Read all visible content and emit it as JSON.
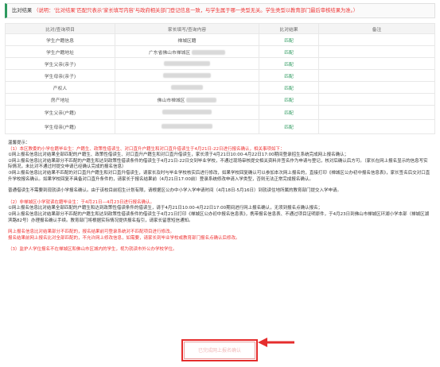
{
  "notice": {
    "label": "比对结果",
    "text": "（说明：‘比对结果’匹配只表示‘家长填写内容’与政府相关部门登记信息一致，与学生属于哪一类型无关。学生类型以教育部门最后审核结果为准。）"
  },
  "table": {
    "headers": [
      "比对/查询项目",
      "家长填写/查询内容",
      "比对结果",
      "备注"
    ],
    "rows": [
      {
        "item": "学生户籍信息",
        "content": "禅城区籍",
        "result": "匹配",
        "note": ""
      },
      {
        "item": "学生户籍地址",
        "content": "广东省佛山市禅城区",
        "result": "匹配",
        "note": ""
      },
      {
        "item": "学生父亲(亲子)",
        "content": "",
        "result": "匹配",
        "note": ""
      },
      {
        "item": "学生母亲(亲子)",
        "content": "",
        "result": "匹配",
        "note": ""
      },
      {
        "item": "产权人",
        "content": "",
        "result": "匹配",
        "note": ""
      },
      {
        "item": "房产地址",
        "content": "佛山市禅城区",
        "result": "匹配",
        "note": ""
      },
      {
        "item": "学生父亲(户籍)",
        "content": "",
        "result": "匹配",
        "note": ""
      },
      {
        "item": "学生母亲(户籍)",
        "content": "",
        "result": "匹配",
        "note": ""
      }
    ]
  },
  "tips": {
    "title": "温馨提示：",
    "s1_heading": "（1）本区教委的小学在籍毕业生：户籍生、政策性借读生、对口直升户籍生和对口直升借读生于4月21日-22日进行报名确认，相关事项如下：",
    "s1_lines": [
      "①网上报名信息比对结果全部匹配的户籍生、政策性借读生、对口直升户籍生和对口直升借读生，家长须于4月21日10:00-4月22日17:00期间登录招生系统完成网上报名确认；",
      "②网上报名信息比对结果部分不匹配的户籍生和达到政策性借读条件的借读生于4月21日-22日交到毕业学校，不通过现场审核提交相关资料并签名作为申请与登记，核对后确认后方可。（家长在网上报名显示的信息写实际情况，未比对不通过时提交申请已经确认完成的报名信息）",
      "③网上报名信息比对结果不匹配的对口直升户籍生和对口直升借读生，请家长及时与毕业学校核实后进行修改，如果学校回复确认可以参加本次网上报名的，直接打印《禅城区公办初中报名信息表》，家长签名后交对口直升学校报名确认。如果学校回复不具备对口直升条件的，请家长于报名结果前（4月21日17:00前）登录系统修改申请入学类型，否则无法正常完成报名确认。",
      "普通借读生不需要到现就读小学报名确认。由于该校目前招生计划有限，请根据区公办中小学入学申请时间（4月18日-5月16日）到就读住地所属的教育部门提交入学申请。"
    ],
    "s2_heading": "（2）非禅城区小学就读在籍毕业生：于4月21日—4月23日进行报名确认。",
    "s2_lines": [
      "①网上报名信息比对结果全部匹配的户籍生和达到政策性借读条件的借读生，请于4月21日10:00-4月22日17:00期间进行网上报名确认，无须到报名点确认报名；",
      "②网上报名信息比对结果部分不匹配的户籍生和达到政策性借读条件的借读生于4月21日打印《禅城区公办初中报名信息表》，携带报名信息表、不通过项目证明原件，于4月23日到佛山市禅城区环湖小学本部（禅城区湖滨路82号）办理报名确认手续。教育部门将根据实际情况提供报名指引，请家长留意短信通知。"
    ],
    "warn1": "网上报名信息比对结果部分不匹配的，报名结果前可登录系统对不匹配项目进行修改。",
    "warn2": "报名结果前网上报名比对全部匹配的，不允许网上修改信息，如需要，请家长到毕业学校或教育部门报名点确认后修改。",
    "s3_heading": "（3）监护人学位报名不在禅城区和佛山市区城内的学生，视为就读市外公办学校学位。"
  },
  "button": {
    "label": "已完成网上报名确认"
  }
}
